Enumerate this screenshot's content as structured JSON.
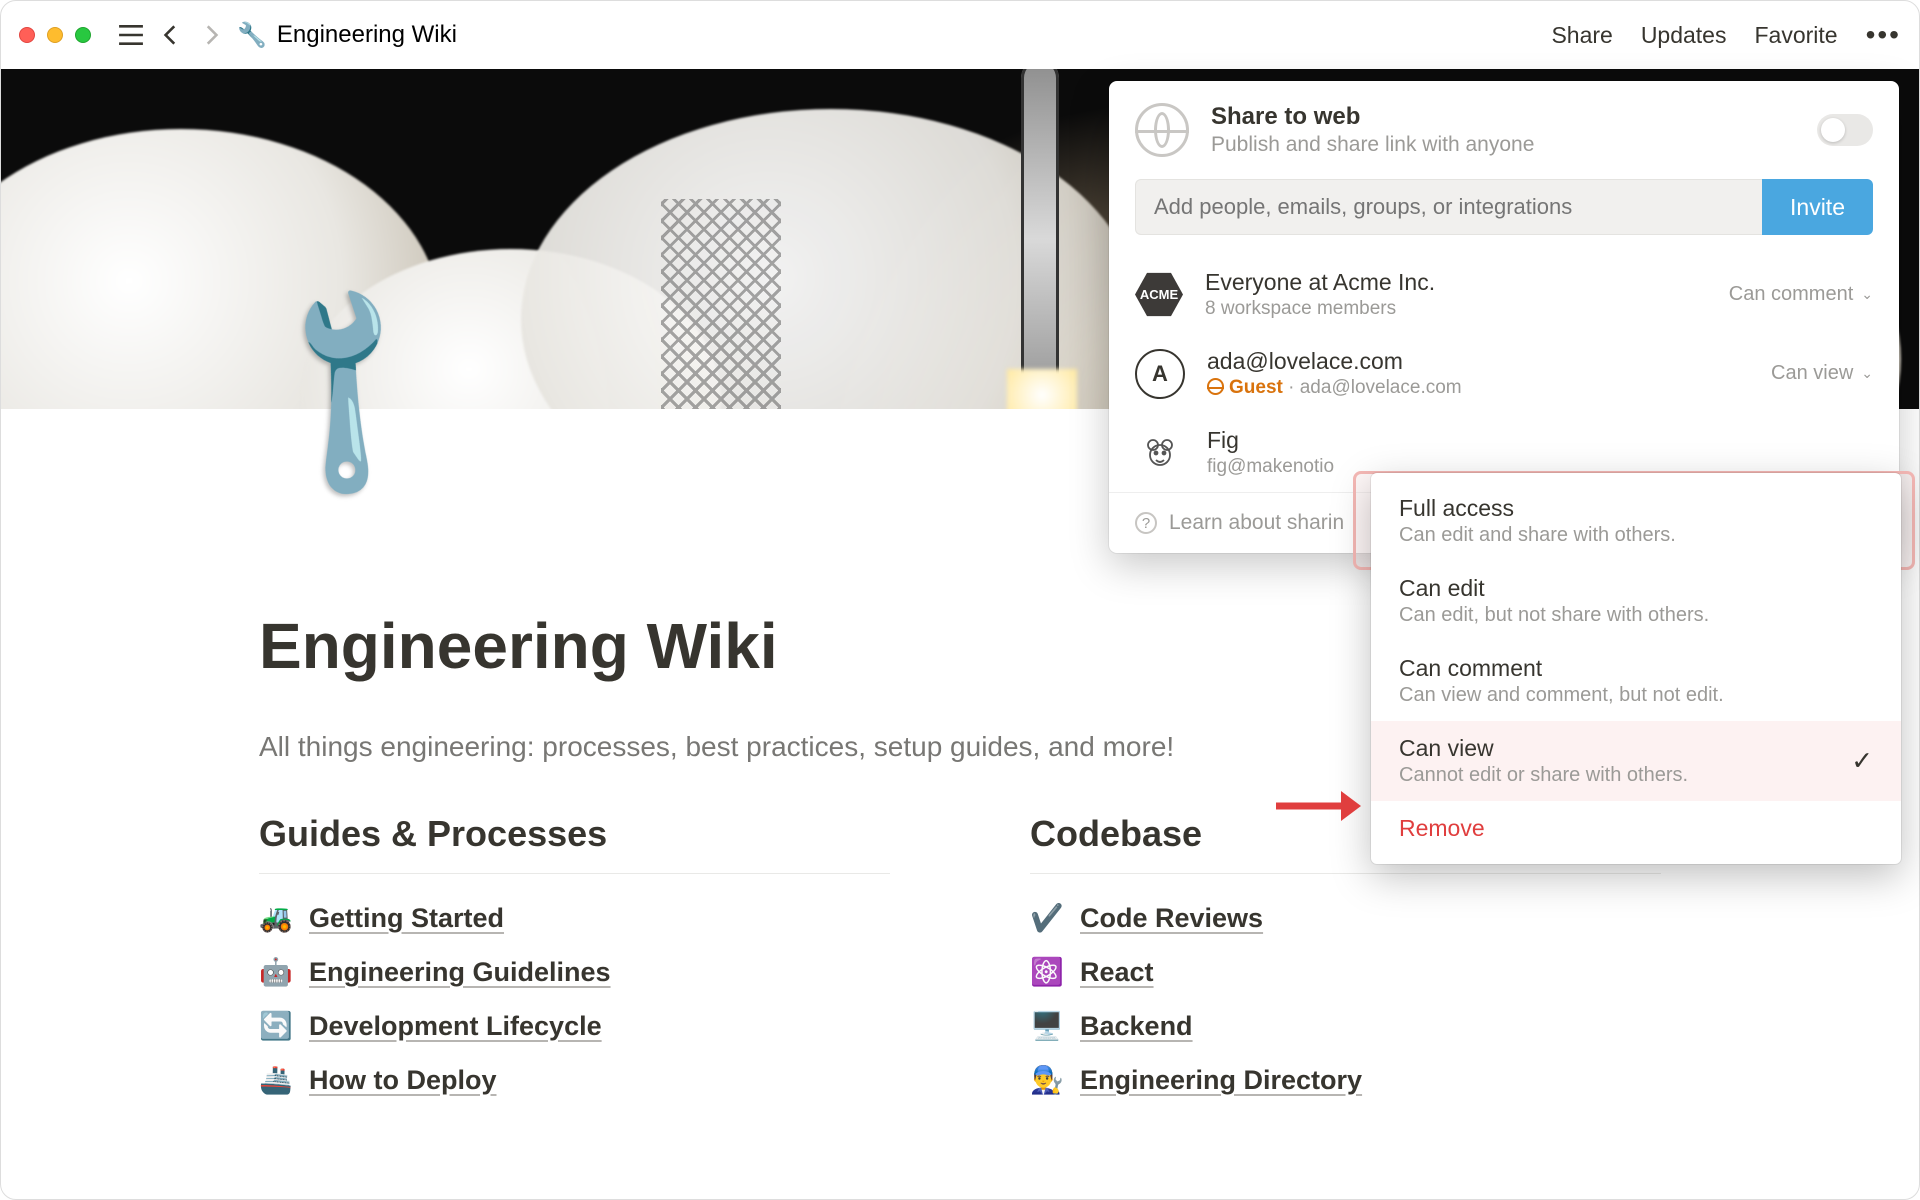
{
  "topbar": {
    "breadcrumb_title": "Engineering Wiki",
    "share": "Share",
    "updates": "Updates",
    "favorite": "Favorite"
  },
  "page": {
    "title": "Engineering Wiki",
    "subtitle": "All things engineering: processes, best practices, setup guides, and more!"
  },
  "columns": {
    "guides": {
      "heading": "Guides & Processes",
      "items": [
        {
          "emoji": "🚜",
          "label": "Getting Started"
        },
        {
          "emoji": "🤖",
          "label": "Engineering Guidelines"
        },
        {
          "emoji": "🔄",
          "label": "Development Lifecycle"
        },
        {
          "emoji": "🚢",
          "label": "How to Deploy"
        }
      ]
    },
    "codebase": {
      "heading": "Codebase",
      "items": [
        {
          "emoji": "✔️",
          "label": "Code Reviews"
        },
        {
          "emoji": "⚛️",
          "label": "React"
        },
        {
          "emoji": "🖥️",
          "label": "Backend"
        },
        {
          "emoji": "👨‍🔧",
          "label": "Engineering Directory"
        }
      ]
    }
  },
  "share_popover": {
    "share_to_web_title": "Share to web",
    "share_to_web_sub": "Publish and share link with anyone",
    "invite_placeholder": "Add people, emails, groups, or integrations",
    "invite_button": "Invite",
    "people": [
      {
        "avatar_text": "ACME",
        "name": "Everyone at Acme Inc.",
        "meta": "8 workspace members",
        "permission": "Can comment"
      },
      {
        "avatar_text": "A",
        "name": "ada@lovelace.com",
        "guest_label": "Guest",
        "meta_suffix": " · ada@lovelace.com",
        "permission": "Can view"
      },
      {
        "avatar_text": "",
        "name": "Fig",
        "meta": "fig@makenotio",
        "permission": ""
      }
    ],
    "footer": "Learn about sharin"
  },
  "permission_menu": {
    "items": [
      {
        "title": "Full access",
        "desc": "Can edit and share with others."
      },
      {
        "title": "Can edit",
        "desc": "Can edit, but not share with others."
      },
      {
        "title": "Can comment",
        "desc": "Can view and comment, but not edit."
      },
      {
        "title": "Can view",
        "desc": "Cannot edit or share with others.",
        "selected": true
      }
    ],
    "remove": "Remove"
  }
}
